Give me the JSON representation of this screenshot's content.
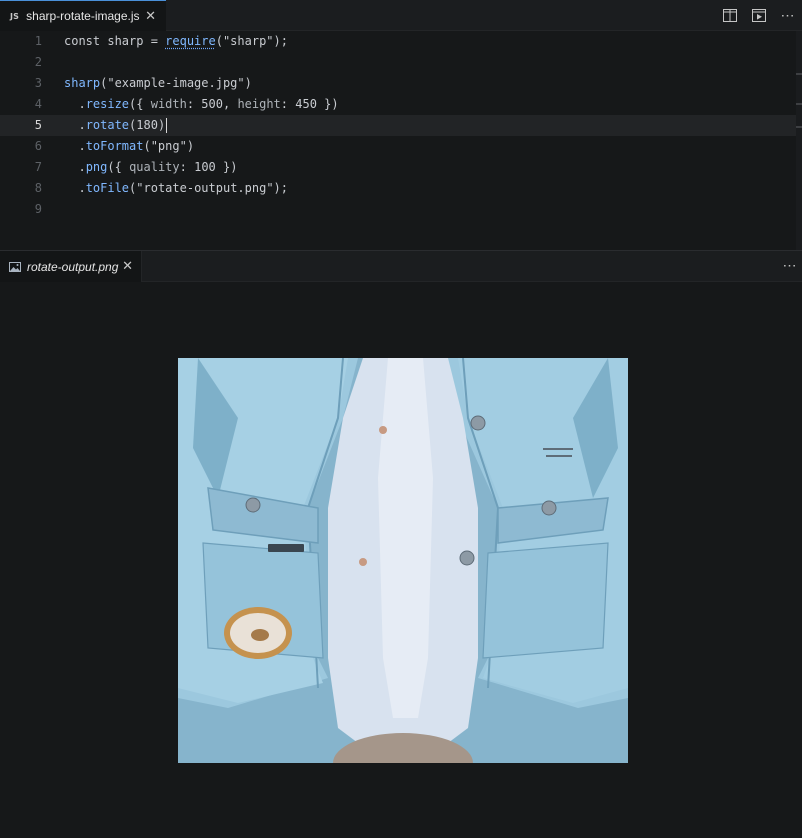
{
  "editor_tab": {
    "badge": "JS",
    "filename": "sharp-rotate-image.js",
    "close": "✕"
  },
  "tab_actions": {
    "split_icon": "split-editor-icon",
    "preview_icon": "open-preview-icon",
    "more": "⋯"
  },
  "code": {
    "active_line": 5,
    "lines": [
      {
        "n": "1",
        "text": "const sharp = require(\"sharp\");"
      },
      {
        "n": "2",
        "text": ""
      },
      {
        "n": "3",
        "text": "sharp(\"example-image.jpg\")"
      },
      {
        "n": "4",
        "text": "  .resize({ width: 500, height: 450 })"
      },
      {
        "n": "5",
        "text": "  .rotate(180)"
      },
      {
        "n": "6",
        "text": "  .toFormat(\"png\")"
      },
      {
        "n": "7",
        "text": "  .png({ quality: 100 })"
      },
      {
        "n": "8",
        "text": "  .toFile(\"rotate-output.png\");"
      },
      {
        "n": "9",
        "text": ""
      }
    ]
  },
  "preview_tab": {
    "icon": "image-file-icon",
    "filename": "rotate-output.png",
    "close": "✕",
    "more": "⋯"
  },
  "preview_image": {
    "alt": "rotated denim jacket image",
    "colors": {
      "denim": "#8fc0d8",
      "background": "#87b5cd",
      "shirt": "#dfe6f2"
    }
  },
  "colors": {
    "accent": "#4a90d9",
    "function": "#80b8ff",
    "editor_bg": "#161819"
  }
}
